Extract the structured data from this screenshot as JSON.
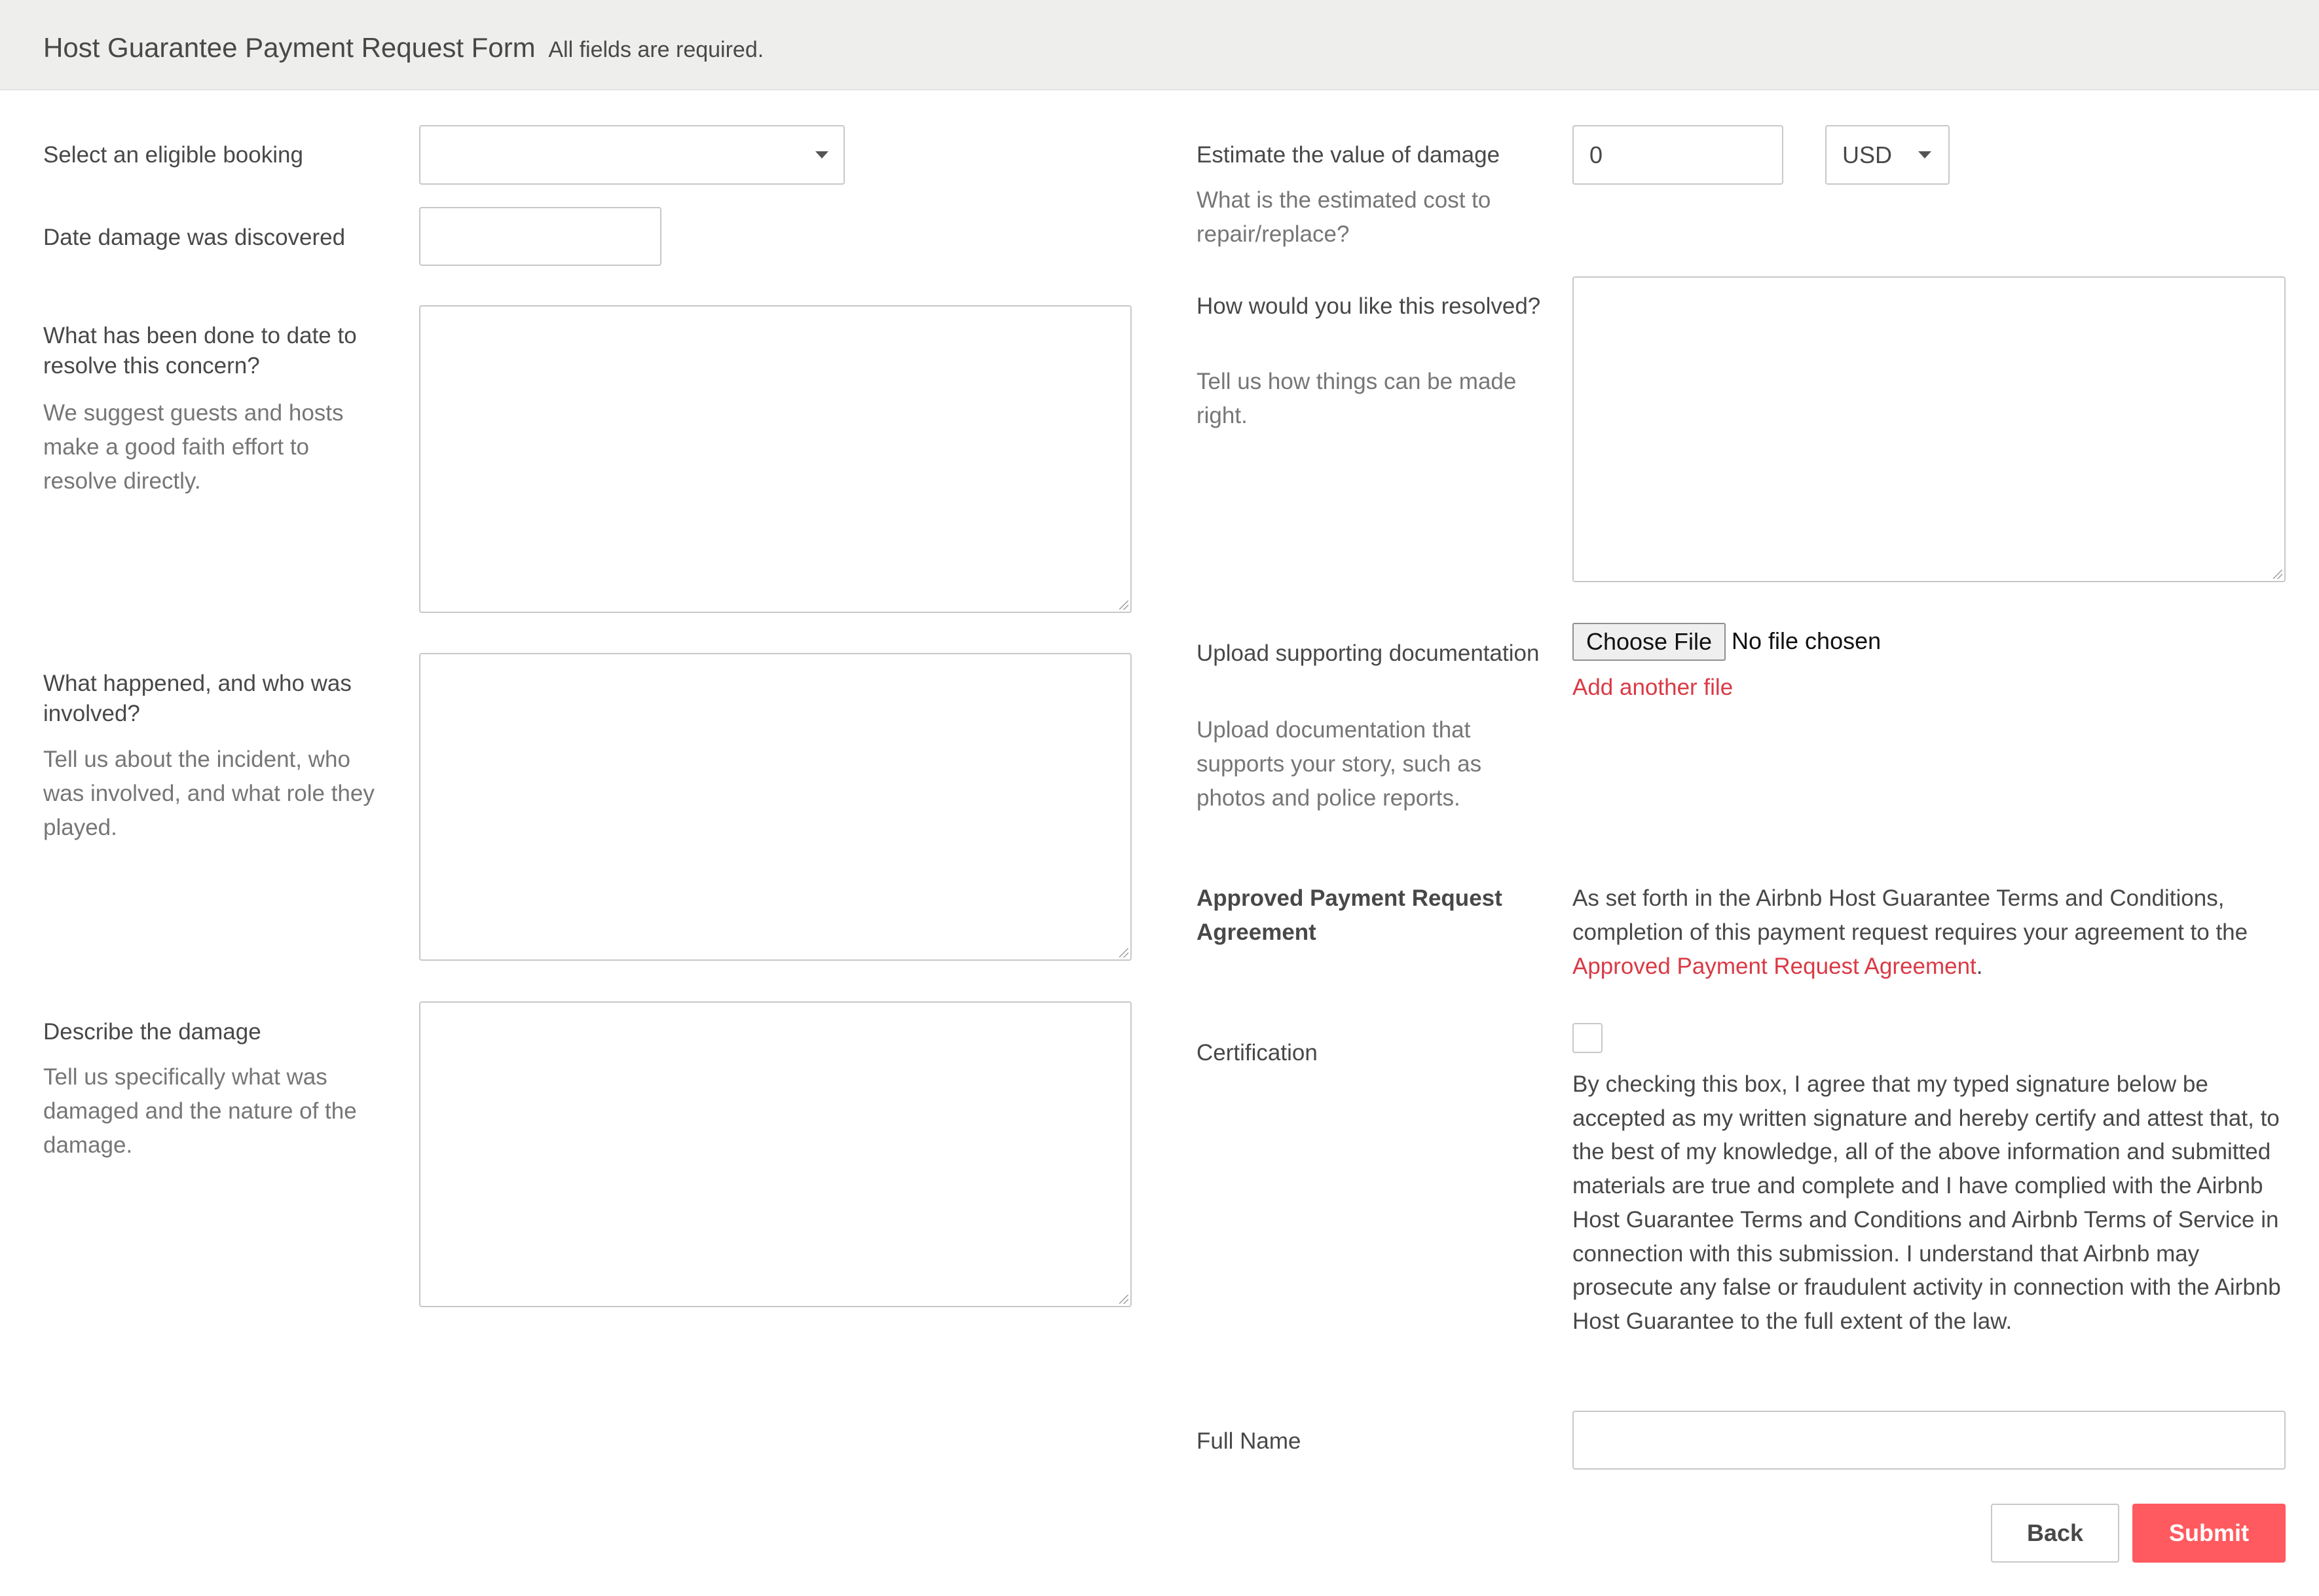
{
  "header": {
    "title": "Host Guarantee Payment Request Form",
    "subtitle": "All fields are required."
  },
  "left": {
    "booking": {
      "label": "Select an eligible booking",
      "value": ""
    },
    "date": {
      "label": "Date damage was discovered",
      "value": ""
    },
    "resolve_done": {
      "label": "What has been done to date to resolve this concern?",
      "hint": "We suggest guests and hosts make a good faith effort to resolve directly."
    },
    "what_happened": {
      "label": "What happened, and who was involved?",
      "hint": "Tell us about the incident, who was involved, and what role they played."
    },
    "damage": {
      "label": "Describe the damage",
      "hint": "Tell us specifically what was damaged and the nature of the damage."
    }
  },
  "right": {
    "estimate": {
      "label": "Estimate the value of damage",
      "hint": "What is the estimated cost to repair/replace?",
      "value": "0",
      "currency": "USD"
    },
    "resolution": {
      "label": "How would you like this resolved?",
      "hint": "Tell us how things can be made right."
    },
    "upload": {
      "label": "Upload supporting documentation",
      "hint": "Upload documentation that supports your story, such as photos and police reports.",
      "button": "Choose File",
      "status": "No file chosen",
      "add_link": "Add another file"
    },
    "agreement": {
      "label": "Approved Payment Request Agreement",
      "text_before": "As set forth in the Airbnb Host Guarantee Terms and Conditions, completion of this payment request requires your agreement to the ",
      "link": "Approved Payment Request Agreement",
      "text_after": "."
    },
    "certification": {
      "label": "Certification",
      "checked": false,
      "text": "By checking this box, I agree that my typed signature below be accepted as my written signature and hereby certify and attest that, to the best of my knowledge, all of the above information and submitted materials are true and complete and I have complied with the Airbnb Host Guarantee Terms and Conditions and Airbnb Terms of Service in connection with this submission. I understand that Airbnb may prosecute any false or fraudulent activity in connection with the Airbnb Host Guarantee to the full extent of the law."
    },
    "full_name": {
      "label": "Full Name",
      "value": ""
    }
  },
  "actions": {
    "back": "Back",
    "submit": "Submit"
  },
  "colors": {
    "accent": "#ff5a5f",
    "link": "#d93a45",
    "header_bg": "#eeefed"
  }
}
